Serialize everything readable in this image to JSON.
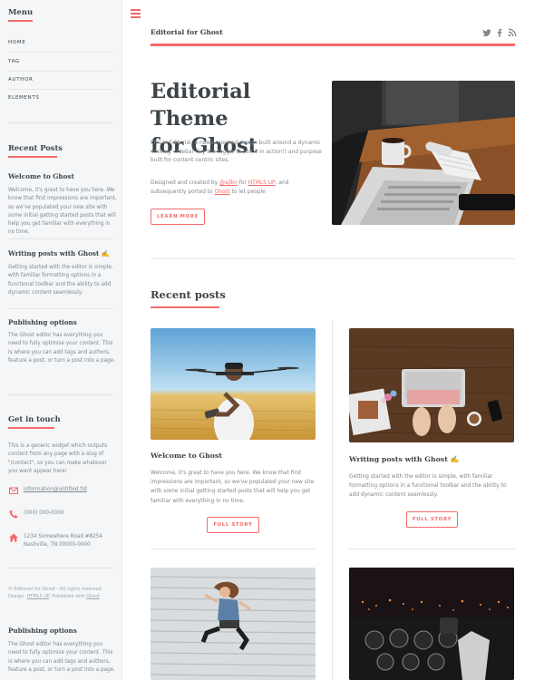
{
  "sidebar": {
    "menu_title": "Menu",
    "menu_items": [
      "HOME",
      "TAG",
      "AUTHOR",
      "ELEMENTS"
    ],
    "recent_title": "Recent Posts",
    "recent_posts": [
      {
        "title": "Welcome to Ghost",
        "excerpt": "Welcome, it's great to have you here. We know that first impressions are important, so we've populated your new site with some initial getting started posts that will help you get familiar with everything in no time."
      },
      {
        "title": "Writing posts with Ghost ✍️",
        "excerpt": "Getting started with the editor is simple, with familiar formatting options in a functional toolbar and the ability to add dynamic content seamlessly."
      },
      {
        "title": "Publishing options",
        "excerpt": "The Ghost editor has everything you need to fully optimise your content. This is where you can add tags and authors, feature a post, or turn a post into a page."
      }
    ],
    "contact_title": "Get in touch",
    "contact_intro": "This is a generic widget which outputs content from any page with a slug of \"/contact\", so you can make whatever you want appear here!",
    "contact_email": "information@untitled.tld",
    "contact_phone": "(000) 000-0000",
    "contact_address_line1": "1234 Somewhere Road #8254",
    "contact_address_line2": "Nashville, TN 00000-0000",
    "footer_line1": "© Editorial for Ghost - All rights reserved",
    "footer_design_prefix": "Design: ",
    "footer_design_link": "HTML5 UP",
    "footer_published_prefix": ". Published with ",
    "footer_published_link": "Ghost",
    "bottom_post_title": "Publishing options",
    "bottom_post_excerpt": "The Ghost editor has everything you need to fully optimise your content. This is where you can add tags and authors, feature a post, or turn a post into a page."
  },
  "header": {
    "site_title": "Editorial for Ghost",
    "social_icons": [
      "twitter-icon",
      "facebook-icon",
      "rss-icon"
    ]
  },
  "banner": {
    "title_line1": "Editorial Theme",
    "title_line2": "for Ghost",
    "description": "This is Editorial, a news-oriented design built around a dynamic 'locking' sidebar (try the toggle to see it in action!) and purpose built for content-centric sites.",
    "credit_prefix": "Designed and created by ",
    "credit_author": "@ajlkn",
    "credit_for": " for ",
    "credit_html5up": "HTML5 UP",
    "credit_middle": ", and subsequently ported to ",
    "credit_ghost": "Ghost",
    "credit_suffix": " to let people",
    "button_label": "LEARN MORE"
  },
  "recent": {
    "title": "Recent posts",
    "posts": [
      {
        "title": "Welcome to Ghost",
        "excerpt": "Welcome, it's great to have you here. We know that first impressions are important, so we've populated your new site with some initial getting started posts that will help you get familiar with everything in no time.",
        "button": "FULL STORY"
      },
      {
        "title": "Writing posts with Ghost ✍️",
        "excerpt": "Getting started with the editor is simple, with familiar formatting options in a functional toolbar and the ability to add dynamic content seamlessly.",
        "button": "FULL STORY"
      }
    ]
  },
  "colors": {
    "accent": "#f56a6a",
    "heading": "#3d4449",
    "text": "#7f888f",
    "sidebar_bg": "#f5f6f7"
  }
}
